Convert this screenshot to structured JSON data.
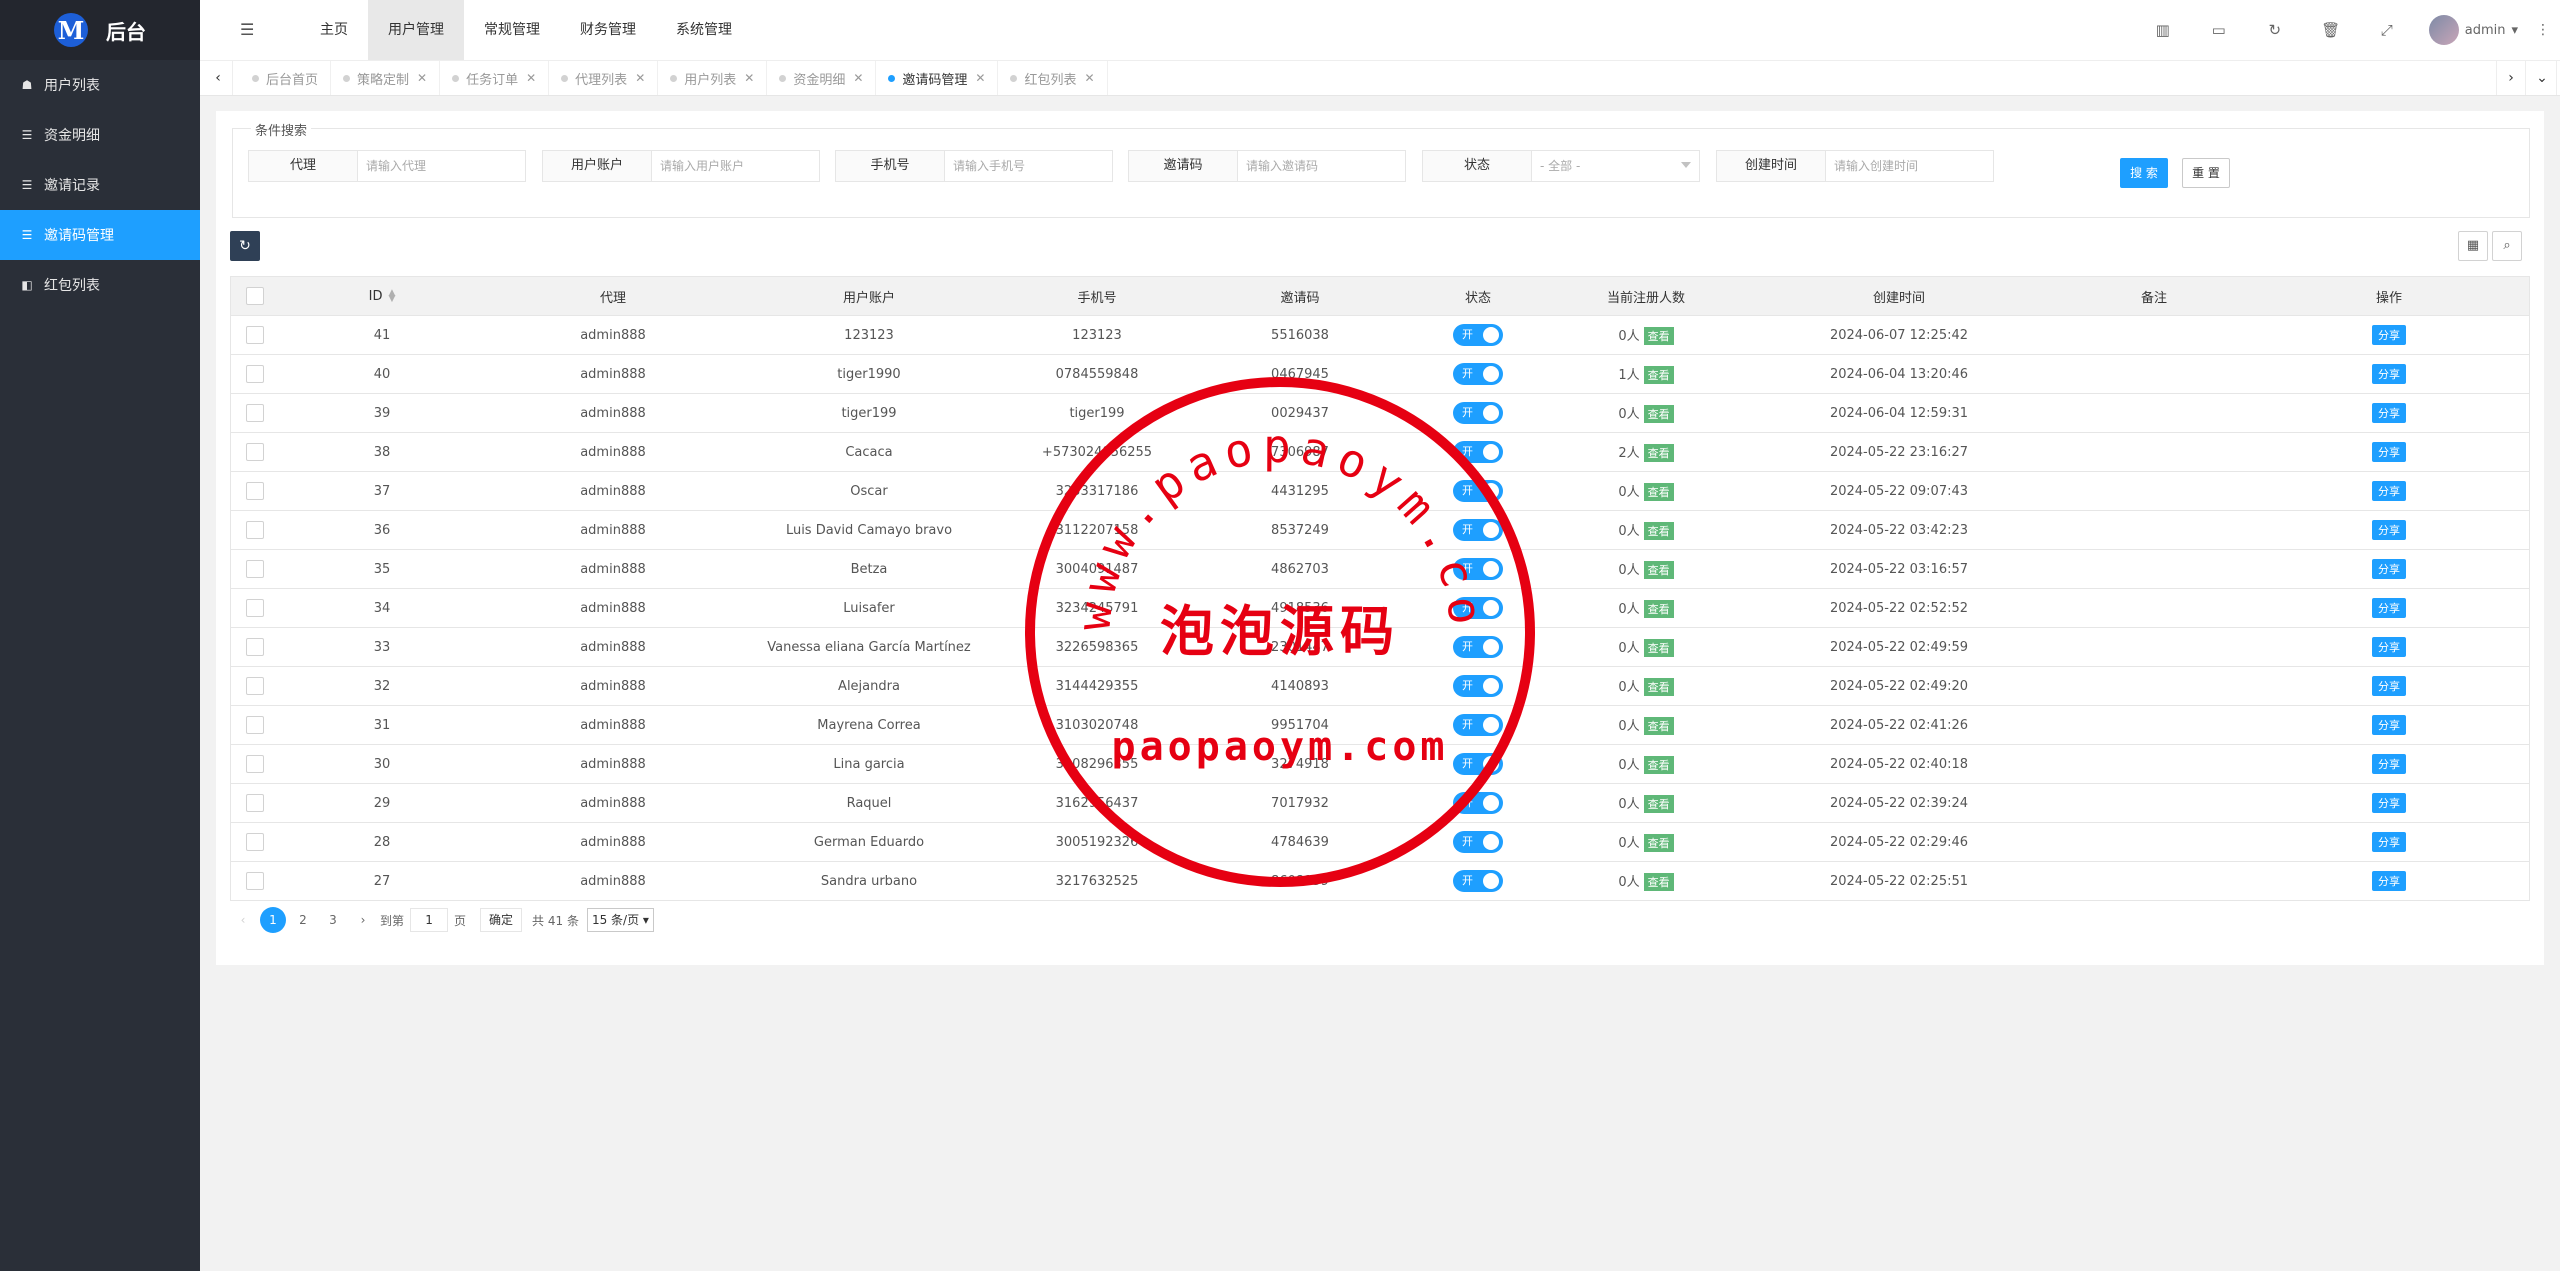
{
  "app": {
    "logo_letter": "M",
    "title": "后台"
  },
  "sidebar": {
    "items": [
      {
        "label": "用户列表",
        "icon": "users-icon",
        "glyph": "☗",
        "active": false
      },
      {
        "label": "资金明细",
        "icon": "list-icon",
        "glyph": "☰",
        "active": false
      },
      {
        "label": "邀请记录",
        "icon": "list-icon",
        "glyph": "☰",
        "active": false
      },
      {
        "label": "邀请码管理",
        "icon": "list-icon",
        "glyph": "☰",
        "active": true
      },
      {
        "label": "红包列表",
        "icon": "redpacket-icon",
        "glyph": "◧",
        "active": false
      }
    ]
  },
  "topnav": {
    "items": [
      "主页",
      "用户管理",
      "常规管理",
      "财务管理",
      "系统管理"
    ],
    "active": "用户管理"
  },
  "header": {
    "user": "admin"
  },
  "tabs": [
    {
      "label": "后台首页",
      "active": false
    },
    {
      "label": "策略定制",
      "active": false
    },
    {
      "label": "任务订单",
      "active": false
    },
    {
      "label": "代理列表",
      "active": false
    },
    {
      "label": "用户列表",
      "active": false
    },
    {
      "label": "资金明细",
      "active": false
    },
    {
      "label": "邀请码管理",
      "active": true
    },
    {
      "label": "红包列表",
      "active": false
    }
  ],
  "search": {
    "legend": "条件搜索",
    "fields": [
      {
        "label": "代理",
        "placeholder": "请输入代理"
      },
      {
        "label": "用户账户",
        "placeholder": "请输入用户账户"
      },
      {
        "label": "手机号",
        "placeholder": "请输入手机号"
      },
      {
        "label": "邀请码",
        "placeholder": "请输入邀请码"
      },
      {
        "label": "状态",
        "placeholder": "- 全部 -",
        "select": true
      },
      {
        "label": "创建时间",
        "placeholder": "请输入创建时间"
      }
    ],
    "search_btn": "搜 索",
    "reset_btn": "重 置"
  },
  "table": {
    "columns": [
      "ID",
      "代理",
      "用户账户",
      "手机号",
      "邀请码",
      "状态",
      "当前注册人数",
      "创建时间",
      "备注",
      "操作"
    ],
    "switch_label": "开",
    "view_label": "查看",
    "share_label": "分享",
    "rows": [
      {
        "id": "41",
        "agent": "admin888",
        "account": "123123",
        "phone": "123123",
        "code": "5516038",
        "count": "0人",
        "created": "2024-06-07 12:25:42",
        "remark": ""
      },
      {
        "id": "40",
        "agent": "admin888",
        "account": "tiger1990",
        "phone": "0784559848",
        "code": "0467945",
        "count": "1人",
        "created": "2024-06-04 13:20:46",
        "remark": ""
      },
      {
        "id": "39",
        "agent": "admin888",
        "account": "tiger199",
        "phone": "tiger199",
        "code": "0029437",
        "count": "0人",
        "created": "2024-06-04 12:59:31",
        "remark": ""
      },
      {
        "id": "38",
        "agent": "admin888",
        "account": "Cacaca",
        "phone": "+573024856255",
        "code": "7306987",
        "count": "2人",
        "created": "2024-05-22 23:16:27",
        "remark": ""
      },
      {
        "id": "37",
        "agent": "admin888",
        "account": "Oscar",
        "phone": "3233317186",
        "code": "4431295",
        "count": "0人",
        "created": "2024-05-22 09:07:43",
        "remark": ""
      },
      {
        "id": "36",
        "agent": "admin888",
        "account": "Luis David Camayo bravo",
        "phone": "3112207158",
        "code": "8537249",
        "count": "0人",
        "created": "2024-05-22 03:42:23",
        "remark": ""
      },
      {
        "id": "35",
        "agent": "admin888",
        "account": "Betza",
        "phone": "3004091487",
        "code": "4862703",
        "count": "0人",
        "created": "2024-05-22 03:16:57",
        "remark": ""
      },
      {
        "id": "34",
        "agent": "admin888",
        "account": "Luisafer",
        "phone": "3234245791",
        "code": "4918536",
        "count": "0人",
        "created": "2024-05-22 02:52:52",
        "remark": ""
      },
      {
        "id": "33",
        "agent": "admin888",
        "account": "Vanessa eliana García Martínez",
        "phone": "3226598365",
        "code": "2301447",
        "count": "0人",
        "created": "2024-05-22 02:49:59",
        "remark": ""
      },
      {
        "id": "32",
        "agent": "admin888",
        "account": "Alejandra",
        "phone": "3144429355",
        "code": "4140893",
        "count": "0人",
        "created": "2024-05-22 02:49:20",
        "remark": ""
      },
      {
        "id": "31",
        "agent": "admin888",
        "account": "Mayrena Correa",
        "phone": "3103020748",
        "code": "9951704",
        "count": "0人",
        "created": "2024-05-22 02:41:26",
        "remark": ""
      },
      {
        "id": "30",
        "agent": "admin888",
        "account": "Lina garcia",
        "phone": "3008296355",
        "code": "3274918",
        "count": "0人",
        "created": "2024-05-22 02:40:18",
        "remark": ""
      },
      {
        "id": "29",
        "agent": "admin888",
        "account": "Raquel",
        "phone": "3162956437",
        "code": "7017932",
        "count": "0人",
        "created": "2024-05-22 02:39:24",
        "remark": ""
      },
      {
        "id": "28",
        "agent": "admin888",
        "account": "German Eduardo",
        "phone": "3005192326",
        "code": "4784639",
        "count": "0人",
        "created": "2024-05-22 02:29:46",
        "remark": ""
      },
      {
        "id": "27",
        "agent": "admin888",
        "account": "Sandra urbano",
        "phone": "3217632525",
        "code": "8608159",
        "count": "0人",
        "created": "2024-05-22 02:25:51",
        "remark": ""
      }
    ]
  },
  "pagination": {
    "pages": [
      "1",
      "2",
      "3"
    ],
    "current": "1",
    "goto_label": "到第",
    "page_value": "1",
    "page_unit": "页",
    "confirm": "确定",
    "total": "共 41 条",
    "page_size": "15 条/页"
  },
  "watermark": {
    "url_text": "www.paopaoym.com",
    "cn_text": "泡泡源码",
    "bottom_text": "paopaoym.com",
    "color": "#e60012"
  },
  "colors": {
    "accent": "#1e9fff",
    "sidebar": "#2a2f38",
    "view_badge": "#5fb878"
  }
}
